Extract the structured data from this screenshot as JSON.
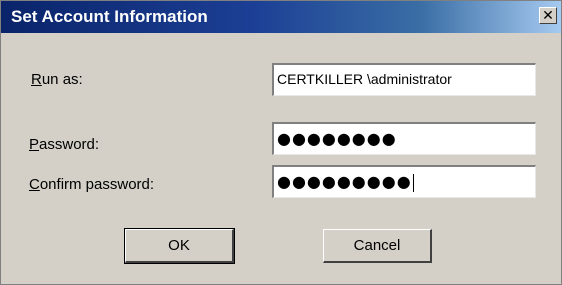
{
  "window": {
    "title": "Set Account Information",
    "close_glyph": "✕"
  },
  "form": {
    "run_as": {
      "label_accel": "R",
      "label_rest": "un as:",
      "value": "CERTKILLER \\administrator"
    },
    "password": {
      "label_accel": "P",
      "label_rest": "assword:",
      "value": "●●●●●●●●"
    },
    "confirm_password": {
      "label_accel": "C",
      "label_rest": "onfirm password:",
      "value": "●●●●●●●●●"
    }
  },
  "buttons": {
    "ok_label": "OK",
    "cancel_label": "Cancel"
  }
}
